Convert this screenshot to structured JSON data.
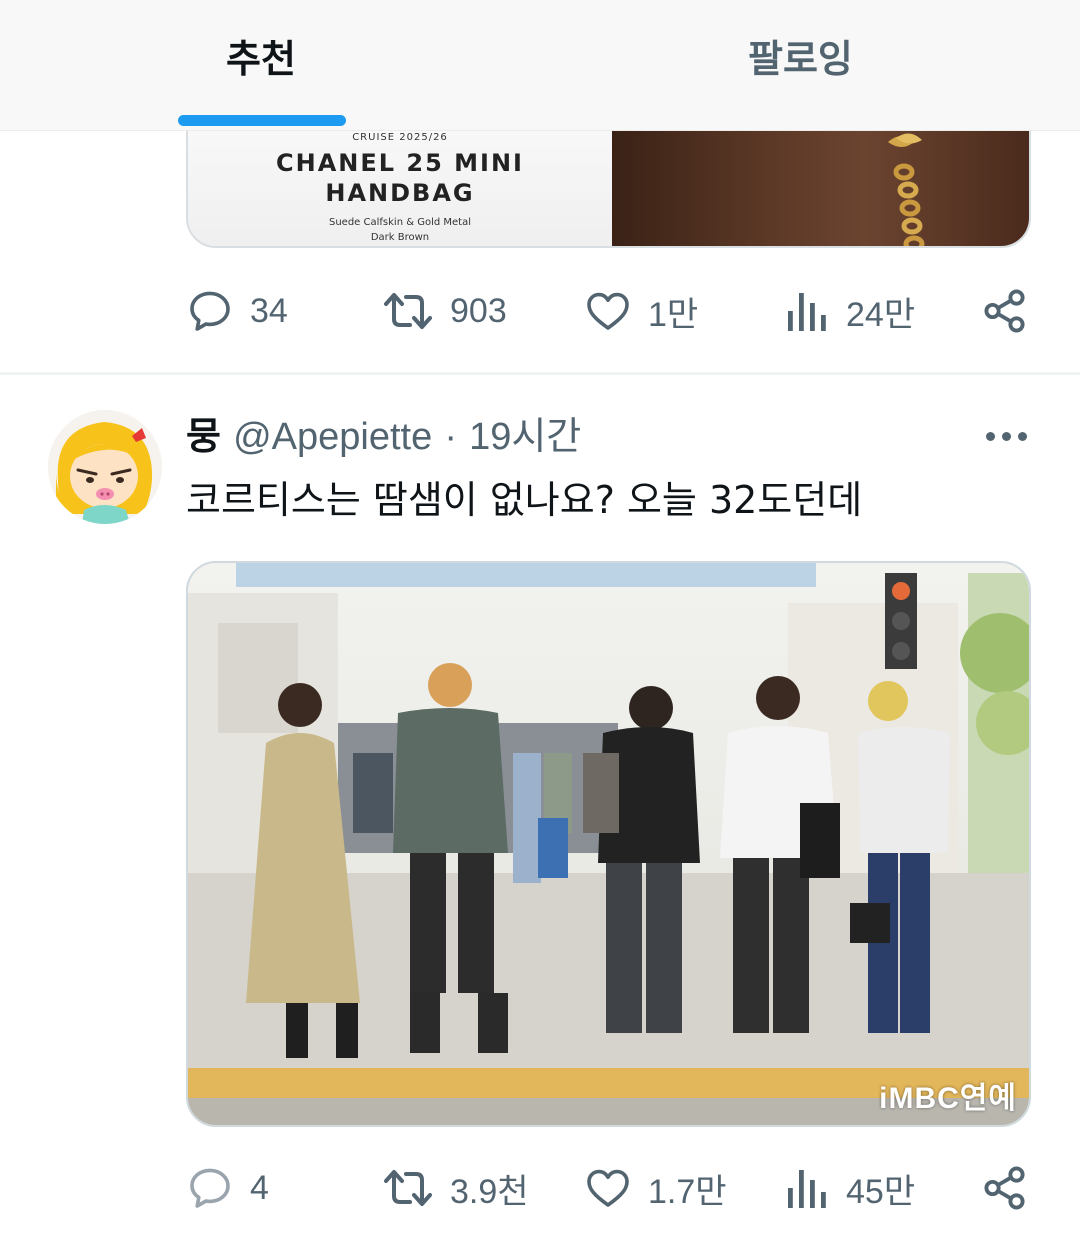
{
  "tabs": {
    "recommended": "추천",
    "following": "팔로잉",
    "accent_color": "#1d9bf0"
  },
  "tweet1": {
    "media": {
      "kicker": "CRUISE 2025/26",
      "title_line1": "CHANEL 25 MINI",
      "title_line2": "HANDBAG",
      "sub_line1": "Suede Calfskin & Gold Metal",
      "sub_line2": "Dark Brown"
    },
    "actions": {
      "replies": "34",
      "retweets": "903",
      "likes": "1만",
      "views": "24만"
    }
  },
  "tweet2": {
    "author": {
      "display_name": "뭉",
      "handle": "@Apepiette",
      "separator": "·",
      "time": "19시간"
    },
    "text": "코르티스는 땀샘이 없나요? 오늘 32도던데",
    "media": {
      "watermark": "iMBC연예"
    },
    "actions": {
      "replies": "4",
      "retweets": "3.9천",
      "likes": "1.7만",
      "views": "45만"
    }
  },
  "icons": {
    "reply": "reply-icon",
    "retweet": "retweet-icon",
    "like": "heart-icon",
    "views": "views-icon",
    "share": "share-icon",
    "more": "more-icon"
  },
  "colors": {
    "text_primary": "#0f1419",
    "text_secondary": "#536471",
    "divider": "#eff3f4"
  }
}
